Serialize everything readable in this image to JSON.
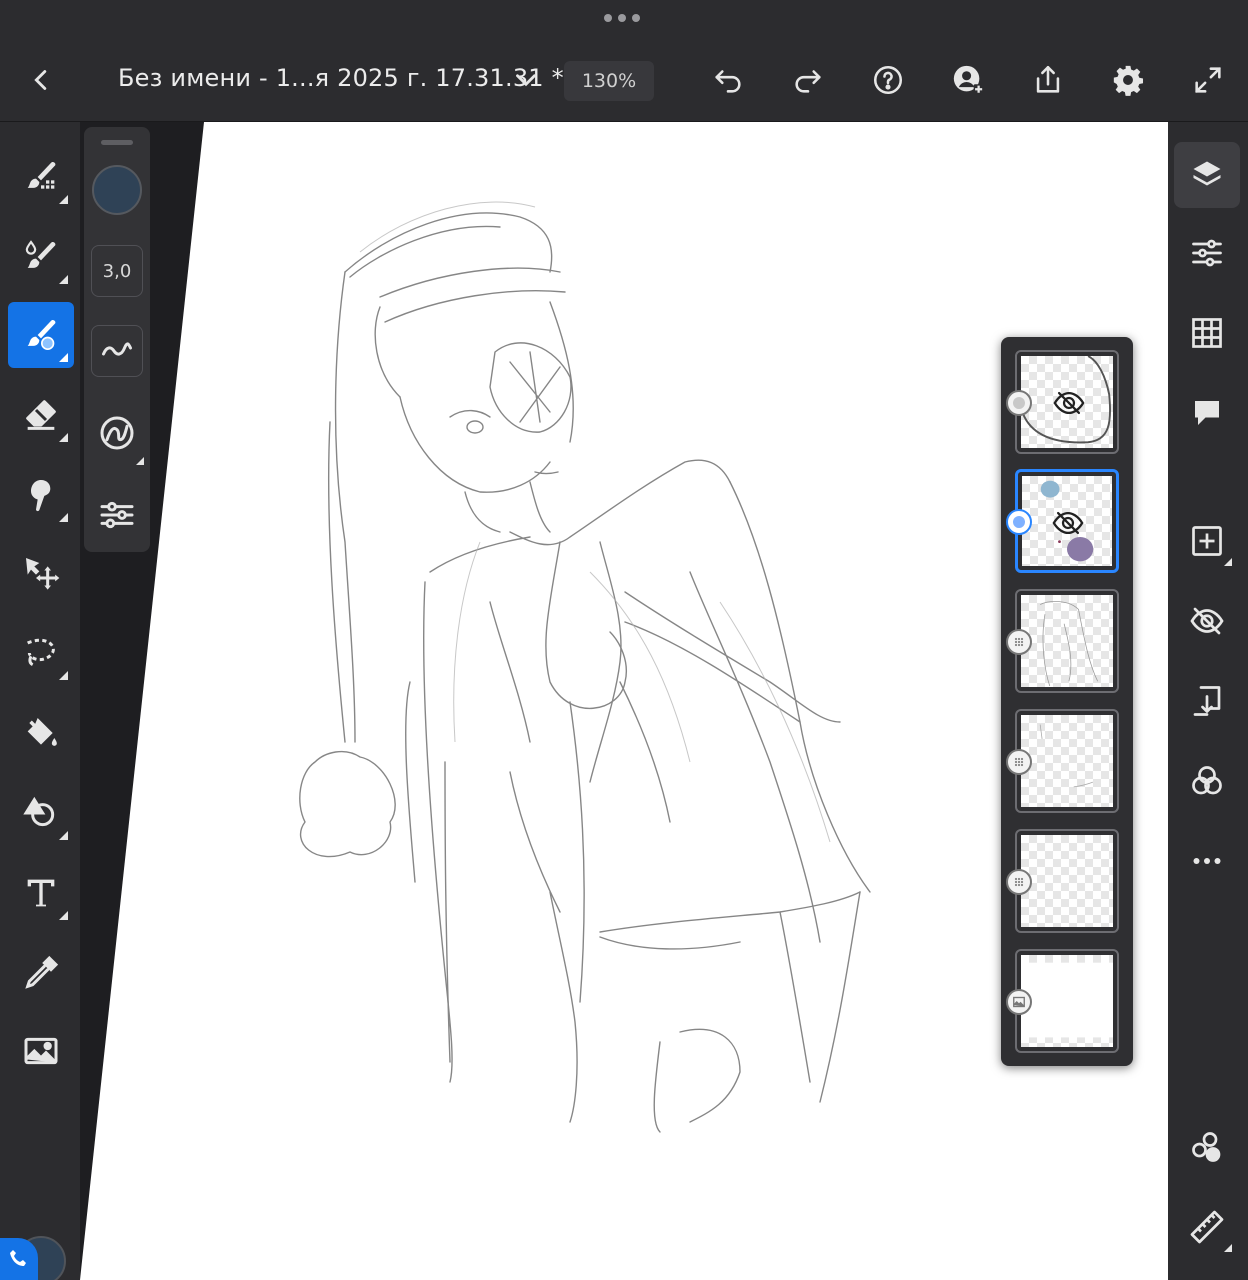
{
  "header": {
    "document_title": "Без имени - 1...я 2025 г. 17.31.31 *",
    "zoom": "130%"
  },
  "brush_panel": {
    "size": "3,0",
    "color": "#2f4256"
  },
  "left_tools": [
    {
      "name": "pixel-brush-tool",
      "icon": "pixel-brush-icon",
      "active": false
    },
    {
      "name": "live-brush-tool",
      "icon": "live-brush-icon",
      "active": false
    },
    {
      "name": "vector-brush-tool",
      "icon": "vector-brush-icon",
      "active": true
    },
    {
      "name": "eraser-tool",
      "icon": "eraser-icon",
      "active": false
    },
    {
      "name": "smudge-tool",
      "icon": "smudge-icon",
      "active": false
    },
    {
      "name": "move-tool",
      "icon": "move-icon",
      "active": false
    },
    {
      "name": "lasso-tool",
      "icon": "lasso-icon",
      "active": false
    },
    {
      "name": "fill-tool",
      "icon": "paint-bucket-icon",
      "active": false
    },
    {
      "name": "shapes-tool",
      "icon": "shapes-icon",
      "active": false
    },
    {
      "name": "text-tool",
      "icon": "text-icon",
      "active": false
    },
    {
      "name": "eyedropper-tool",
      "icon": "eyedropper-icon",
      "active": false
    },
    {
      "name": "image-tool",
      "icon": "image-icon",
      "active": false
    }
  ],
  "right_tools": [
    {
      "name": "layers-panel",
      "icon": "layers-icon",
      "active": true
    },
    {
      "name": "layer-properties",
      "icon": "sliders-icon",
      "active": false
    },
    {
      "name": "grid-toggle",
      "icon": "grid-icon",
      "active": false
    },
    {
      "name": "comments",
      "icon": "comment-icon",
      "active": false
    },
    {
      "name": "add-layer",
      "icon": "add-layer-icon",
      "active": false
    },
    {
      "name": "hide-layer",
      "icon": "eye-slash-icon",
      "active": false
    },
    {
      "name": "merge-down",
      "icon": "merge-down-icon",
      "active": false
    },
    {
      "name": "blend-modes",
      "icon": "blend-icon",
      "active": false
    },
    {
      "name": "more-options",
      "icon": "more-icon",
      "active": false
    },
    {
      "name": "tutorials",
      "icon": "shapes-stack-icon",
      "active": false
    },
    {
      "name": "ruler",
      "icon": "ruler-icon",
      "active": false
    }
  ],
  "layers": [
    {
      "name": "layer-1",
      "kind": "vector",
      "hidden": true,
      "selected": false
    },
    {
      "name": "layer-2",
      "kind": "vector",
      "hidden": true,
      "selected": true
    },
    {
      "name": "layer-3",
      "kind": "pixel",
      "hidden": false,
      "selected": false
    },
    {
      "name": "layer-4",
      "kind": "pixel",
      "hidden": false,
      "selected": false
    },
    {
      "name": "layer-5",
      "kind": "pixel",
      "hidden": false,
      "selected": false
    },
    {
      "name": "background-layer",
      "kind": "image",
      "hidden": false,
      "selected": false
    }
  ],
  "colors": {
    "accent": "#1473e6",
    "selection": "#2a86ff",
    "current_color": "#2f4256"
  }
}
